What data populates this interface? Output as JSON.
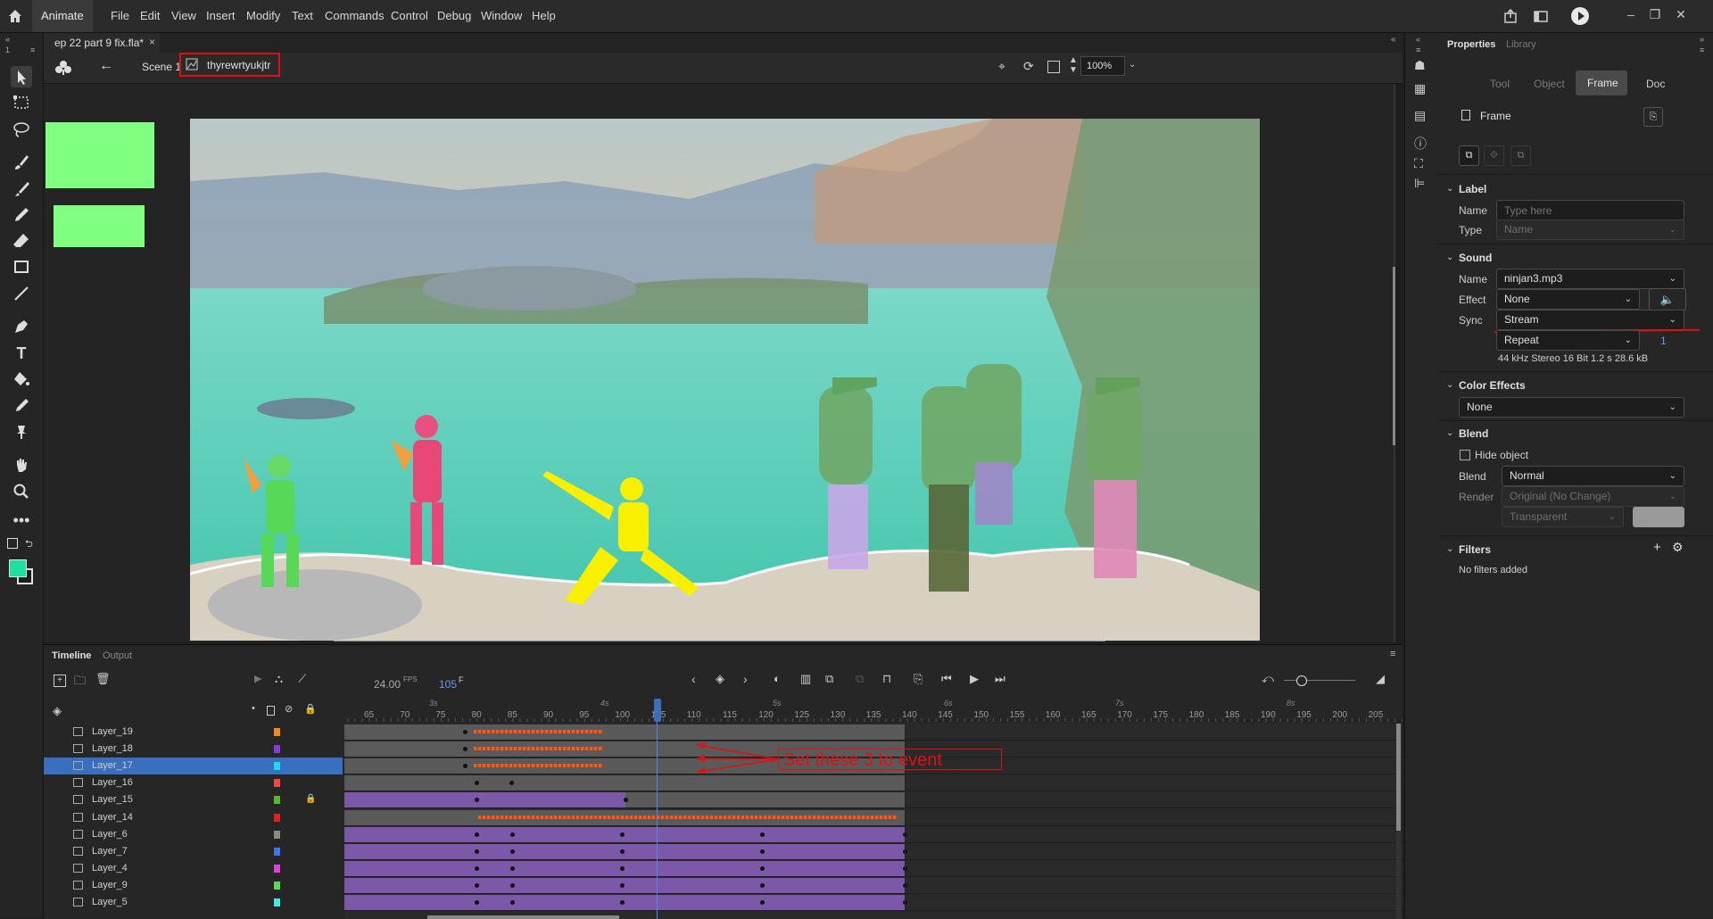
{
  "app": {
    "name": "Animate",
    "menus": [
      "File",
      "Edit",
      "View",
      "Insert",
      "Modify",
      "Text",
      "Commands",
      "Control",
      "Debug",
      "Window",
      "Help"
    ]
  },
  "document": {
    "tab_title": "ep 22 part 9 fix.fla*",
    "close_glyph": "×",
    "scene": "Scene 1",
    "symbol": "thyrewrtyukjtr",
    "zoom": "100%"
  },
  "timeline": {
    "tabs": [
      "Timeline",
      "Output"
    ],
    "fps": "24.00",
    "fps_unit": "FPS",
    "current_frame": "105",
    "frame_unit": "F",
    "second_labels": [
      "3s",
      "4s",
      "5s",
      "6s",
      "7s",
      "8s"
    ],
    "frame_numbers": [
      "65",
      "70",
      "75",
      "80",
      "85",
      "90",
      "95",
      "100",
      "105",
      "110",
      "115",
      "120",
      "125",
      "130",
      "135",
      "140",
      "145",
      "150",
      "155",
      "160",
      "165",
      "170",
      "175",
      "180",
      "185",
      "190",
      "195",
      "200",
      "205"
    ],
    "layers": [
      {
        "name": "Layer_19",
        "color": "#f08a1c",
        "selected": false,
        "locked": false
      },
      {
        "name": "Layer_18",
        "color": "#8a3ad8",
        "selected": false,
        "locked": false
      },
      {
        "name": "Layer_17",
        "color": "#22d8f0",
        "selected": true,
        "locked": false
      },
      {
        "name": "Layer_16",
        "color": "#f04848",
        "selected": false,
        "locked": false
      },
      {
        "name": "Layer_15",
        "color": "#56b828",
        "selected": false,
        "locked": true
      },
      {
        "name": "Layer_14",
        "color": "#e02020",
        "selected": false,
        "locked": false
      },
      {
        "name": "Layer_6",
        "color": "#8a8a8a",
        "selected": false,
        "locked": false
      },
      {
        "name": "Layer_7",
        "color": "#3a78f0",
        "selected": false,
        "locked": false
      },
      {
        "name": "Layer_4",
        "color": "#e040e0",
        "selected": false,
        "locked": false
      },
      {
        "name": "Layer_9",
        "color": "#58d858",
        "selected": false,
        "locked": false
      },
      {
        "name": "Layer_5",
        "color": "#40e8e8",
        "selected": false,
        "locked": false
      }
    ],
    "annotation": "Set these 3 to event"
  },
  "panel": {
    "tabs": [
      "Properties",
      "Library"
    ],
    "subtabs": [
      "Tool",
      "Object",
      "Frame",
      "Doc"
    ],
    "active_subtab": "Frame",
    "heading": "Frame",
    "label_section": {
      "title": "Label",
      "name_label": "Name",
      "name_placeholder": "Type here",
      "type_label": "Type",
      "type_value": "Name"
    },
    "sound_section": {
      "title": "Sound",
      "name_label": "Name",
      "name_value": "ninjan3.mp3",
      "effect_label": "Effect",
      "effect_value": "None",
      "sync_label": "Sync",
      "sync_value": "Stream",
      "repeat_value": "Repeat",
      "repeat_count": "1",
      "info": "44 kHz Stereo 16 Bit 1.2 s 28.6 kB"
    },
    "color_effects": {
      "title": "Color Effects",
      "value": "None"
    },
    "blend_section": {
      "title": "Blend",
      "hide_object": "Hide object",
      "blend_label": "Blend",
      "blend_value": "Normal",
      "render_label": "Render",
      "render_value": "Original (No Change)",
      "bg_value": "Transparent"
    },
    "filters": {
      "title": "Filters",
      "empty": "No filters added"
    }
  },
  "colors": {
    "accent": "#3a6fbf",
    "stroke": "#1d1d1d",
    "fill": "#1ee0a0",
    "annotation_red": "#e01010",
    "layer_purple": "#7b58a8",
    "pasteboard_green": "#80ff80"
  }
}
